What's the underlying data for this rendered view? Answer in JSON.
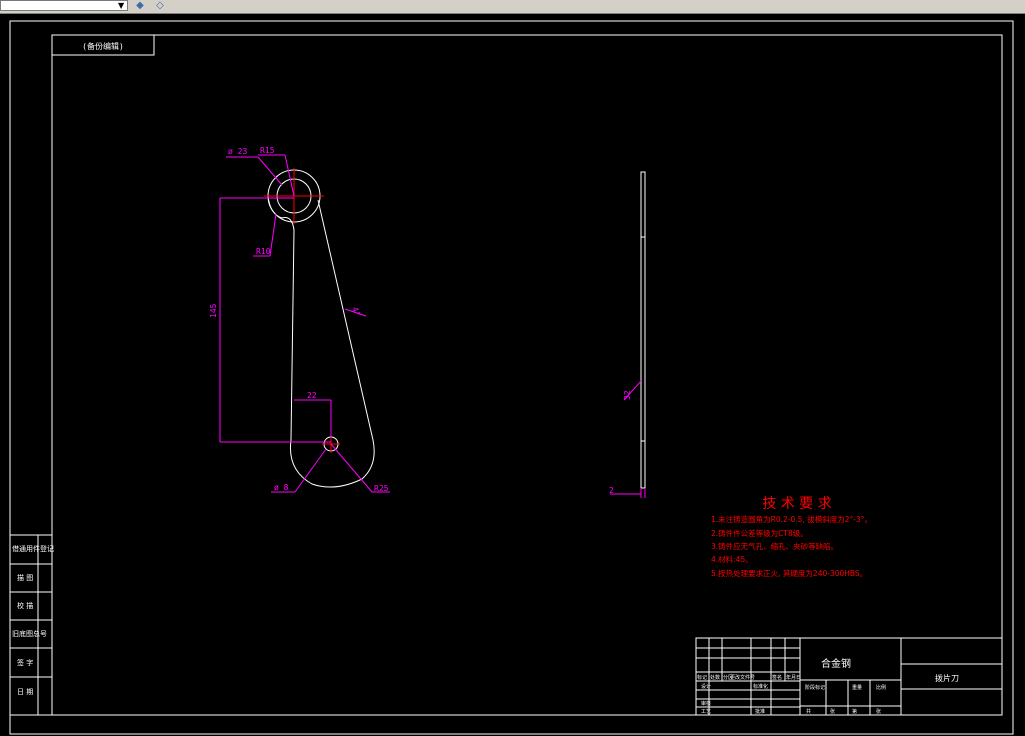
{
  "colors": {
    "background": "#000000",
    "border": "#ffffff",
    "dimension": "#ff00ff",
    "centerline": "#ff0000",
    "notes": "#ff0000"
  },
  "toolbar": {
    "icons": [
      "layer-tool-icon",
      "layer-states-icon"
    ]
  },
  "title_tag": "(备份编辑)",
  "dims": {
    "d23": "ø 23",
    "r15": "R15",
    "r10": "R10",
    "len145": "145",
    "len22": "22",
    "d8": "ø 8",
    "r25": "R25",
    "angle": "4°",
    "side32": "32",
    "thick2": "2"
  },
  "tech": {
    "title": "技 术 要 求",
    "notes": [
      "1.未注铸造圆角为R0.2-0.5, 拔模斜度为2°-3°。",
      "2.铸件件公差等级为CT8级。",
      "3.铸件应无气孔、缩孔、夹砂等缺陷。",
      "4.材料:45。",
      "5.按热处理要求正火, 其硬度为240-300HBS。"
    ]
  },
  "side_labels": [
    "借通用件登记",
    "描 图",
    "校 描",
    "旧底图总号",
    "签 字",
    "日 期"
  ],
  "title_block": {
    "material": "合金钢",
    "part_name": "拨片刀",
    "row_labels": [
      "标记",
      "处数",
      "分区",
      "更改文件号",
      "签名",
      "年月日"
    ],
    "design": "设计",
    "standard": "标准化",
    "stage_mark": "阶段标记",
    "weight": "重量",
    "scale": "比例",
    "review": "审核",
    "craft": "工艺",
    "approve": "批准",
    "sheets": "共",
    "sheet": "第",
    "zhang1": "张",
    "zhang2": "张"
  }
}
